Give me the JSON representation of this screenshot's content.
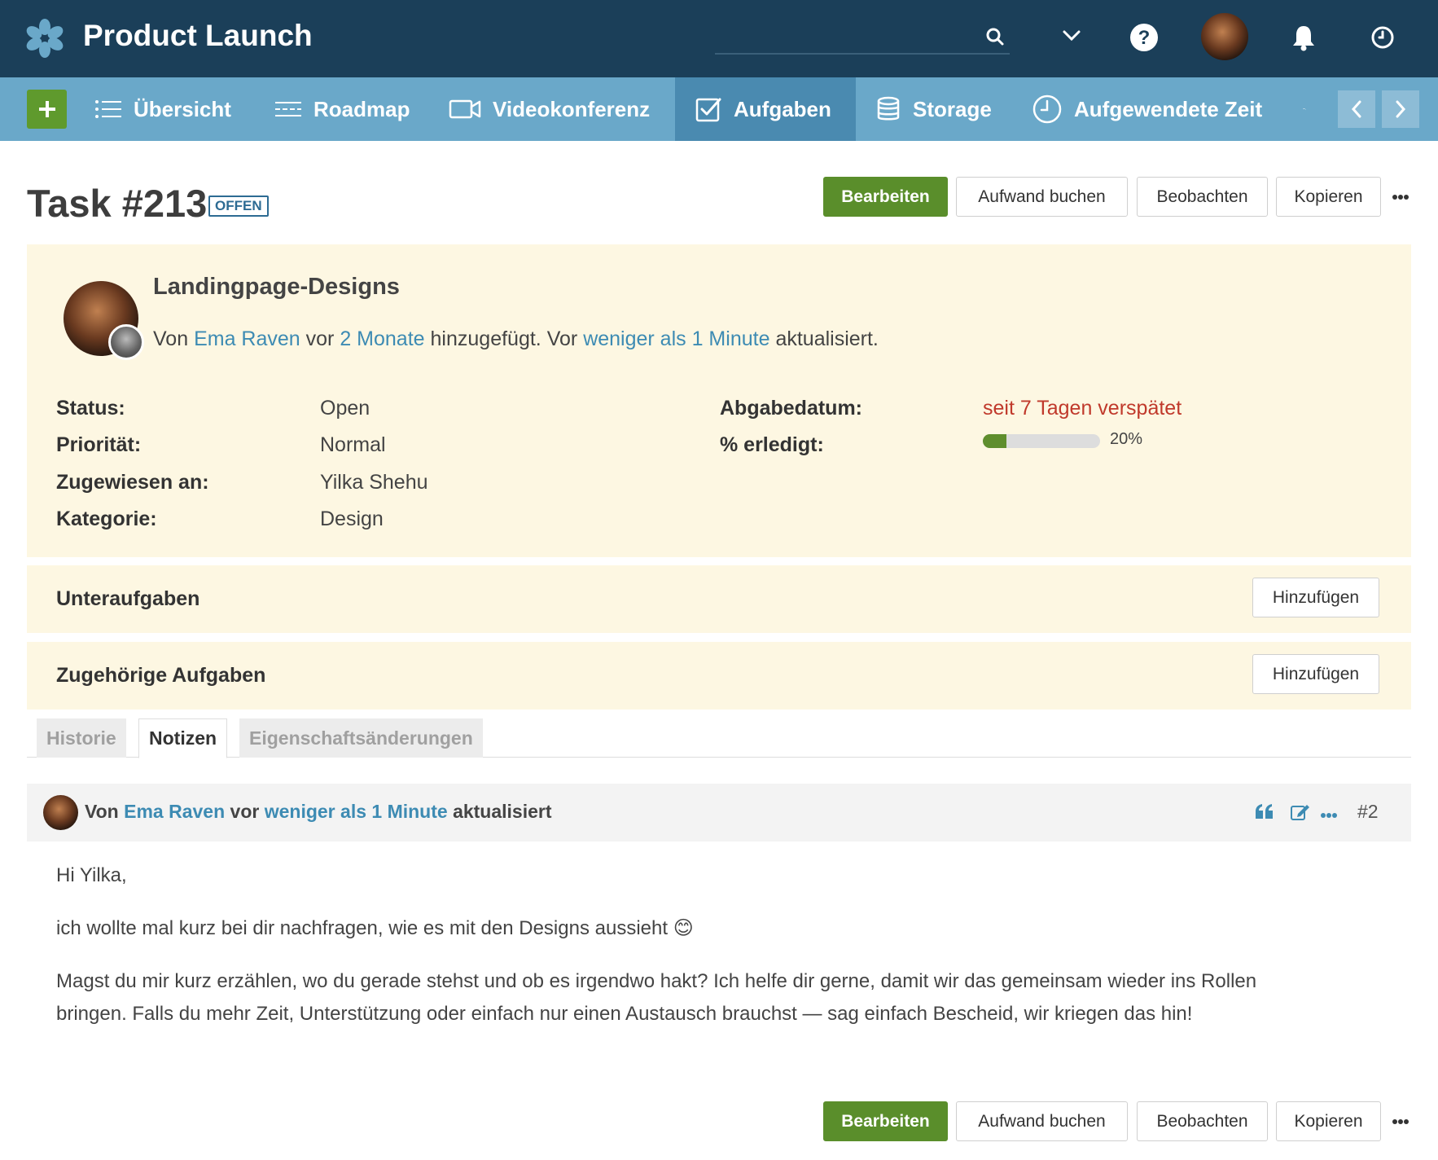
{
  "app": {
    "title": "Product Launch",
    "logo_icon": "asterisk-logo-icon"
  },
  "search": {
    "placeholder": "",
    "value": ""
  },
  "nav": {
    "add_icon": "plus-icon",
    "items": [
      {
        "label": "Übersicht",
        "icon": "list-icon",
        "active": false
      },
      {
        "label": "Roadmap",
        "icon": "roadmap-icon",
        "active": false
      },
      {
        "label": "Videokonferenz",
        "icon": "video-icon",
        "active": false
      },
      {
        "label": "Aufgaben",
        "icon": "checkbox-icon",
        "active": true
      },
      {
        "label": "Storage",
        "icon": "database-icon",
        "active": false
      },
      {
        "label": "Aufgewendete Zeit",
        "icon": "clock-icon",
        "active": false
      }
    ]
  },
  "task": {
    "title": "Task #213",
    "badge": "OFFEN",
    "subject": "Landingpage-Designs",
    "byline": {
      "prefix": "Von",
      "author": "Ema Raven",
      "mid1": "vor",
      "created": "2 Monate",
      "mid2": "hinzugefügt. Vor",
      "updated": "weniger als 1 Minute",
      "suffix": "aktualisiert."
    },
    "attributes": {
      "status_label": "Status:",
      "status_value": "Open",
      "priority_label": "Priorität:",
      "priority_value": "Normal",
      "assignee_label": "Zugewiesen an:",
      "assignee_value": "Yilka Shehu",
      "category_label": "Kategorie:",
      "category_value": "Design",
      "due_label": "Abgabedatum:",
      "due_value": "seit 7 Tagen verspätet",
      "done_label": "% erledigt:",
      "done_value": "20%",
      "done_fraction": 0.2
    }
  },
  "actions": {
    "edit": "Bearbeiten",
    "log_time": "Aufwand buchen",
    "watch": "Beobachten",
    "copy": "Kopieren"
  },
  "sections": {
    "subtasks": {
      "title": "Unteraufgaben",
      "button": "Hinzufügen"
    },
    "related": {
      "title": "Zugehörige Aufgaben",
      "button": "Hinzufügen"
    }
  },
  "tabs": [
    {
      "label": "Historie",
      "active": false
    },
    {
      "label": "Notizen",
      "active": true
    },
    {
      "label": "Eigenschaftsänderungen",
      "active": false
    }
  ],
  "note": {
    "prefix": "Von",
    "author": "Ema Raven",
    "mid": "vor",
    "time": "weniger als 1 Minute",
    "suffix": "aktualisiert",
    "number": "#2",
    "paragraphs": [
      "Hi Yilka,",
      "ich wollte mal kurz bei dir nachfragen, wie es mit den Designs aussieht 😊",
      "Magst du mir kurz erzählen, wo du gerade stehst und ob es irgendwo hakt? Ich helfe dir gerne, damit wir das gemeinsam wieder ins Rollen bringen. Falls du mehr Zeit, Unterstützung oder einfach nur einen Austausch brauchst — sag einfach Bescheid, wir kriegen das hin!"
    ]
  },
  "colors": {
    "topbar": "#1b3f59",
    "navbar": "#6aa8c9",
    "primary": "#5a8e2b",
    "link": "#3d8bb3",
    "late": "#c0392b",
    "panel": "#fdf7e2"
  }
}
